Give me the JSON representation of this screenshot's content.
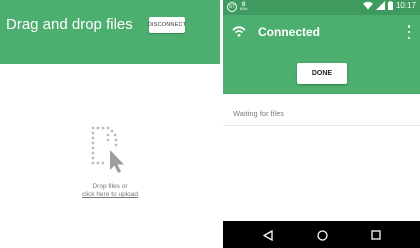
{
  "web": {
    "header_title": "Drag and drop files",
    "disconnect_label": "DISCONNECT",
    "drop_text": "Drop files or",
    "upload_link": "click here to upload",
    "colors": {
      "header": "#4caf6f"
    },
    "icons": {
      "drop": "drag-drop-file-icon"
    }
  },
  "phone": {
    "status_bar": {
      "notification_badge": "67",
      "speed_value": "0",
      "speed_unit": "KB/s",
      "time": "10:17"
    },
    "app_bar": {
      "title": "Connected",
      "icons": {
        "wifi": "wifi-icon",
        "menu": "overflow-menu-icon"
      }
    },
    "done_label": "DONE",
    "waiting_text": "Waiting for files",
    "nav_icons": [
      "back-icon",
      "home-icon",
      "recents-icon"
    ],
    "colors": {
      "app_bar": "#4caf6f",
      "status_bar": "#3e9a5e",
      "nav_bar": "#000000"
    }
  }
}
